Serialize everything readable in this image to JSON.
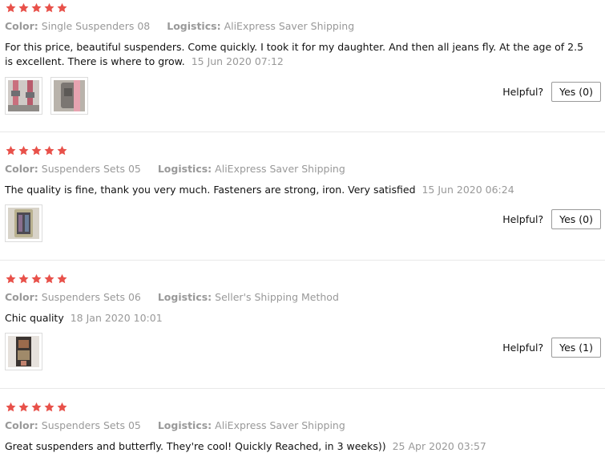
{
  "labels": {
    "color": "Color:",
    "logistics": "Logistics:",
    "helpful": "Helpful?"
  },
  "colors": {
    "star": "#e8514a",
    "muted_text": "#999999",
    "divider": "#e8e8e8"
  },
  "reviews": [
    {
      "rating": 5,
      "color": "Single Suspenders 08",
      "logistics": "AliExpress Saver Shipping",
      "text": "For this price, beautiful suspenders. Come quickly. I took it for my daughter. And then all jeans fly. At the age of 2.5 is excellent. There is where to grow.",
      "date": "15 Jun 2020 07:12",
      "photo_count": 2,
      "yes_label": "Yes (0)"
    },
    {
      "rating": 5,
      "color": "Suspenders Sets 05",
      "logistics": "AliExpress Saver Shipping",
      "text": "The quality is fine, thank you very much. Fasteners are strong, iron. Very satisfied",
      "date": "15 Jun 2020 06:24",
      "photo_count": 1,
      "yes_label": "Yes (0)"
    },
    {
      "rating": 5,
      "color": "Suspenders Sets 06",
      "logistics": "Seller's Shipping Method",
      "text": "Chic quality",
      "date": "18 Jan 2020 10:01",
      "photo_count": 1,
      "yes_label": "Yes (1)"
    },
    {
      "rating": 5,
      "color": "Suspenders Sets 05",
      "logistics": "AliExpress Saver Shipping",
      "text": "Great suspenders and butterfly. They're cool! Quickly Reached, in 3 weeks))",
      "date": "25 Apr 2020 03:57",
      "photo_count": 0,
      "yes_label": ""
    }
  ]
}
